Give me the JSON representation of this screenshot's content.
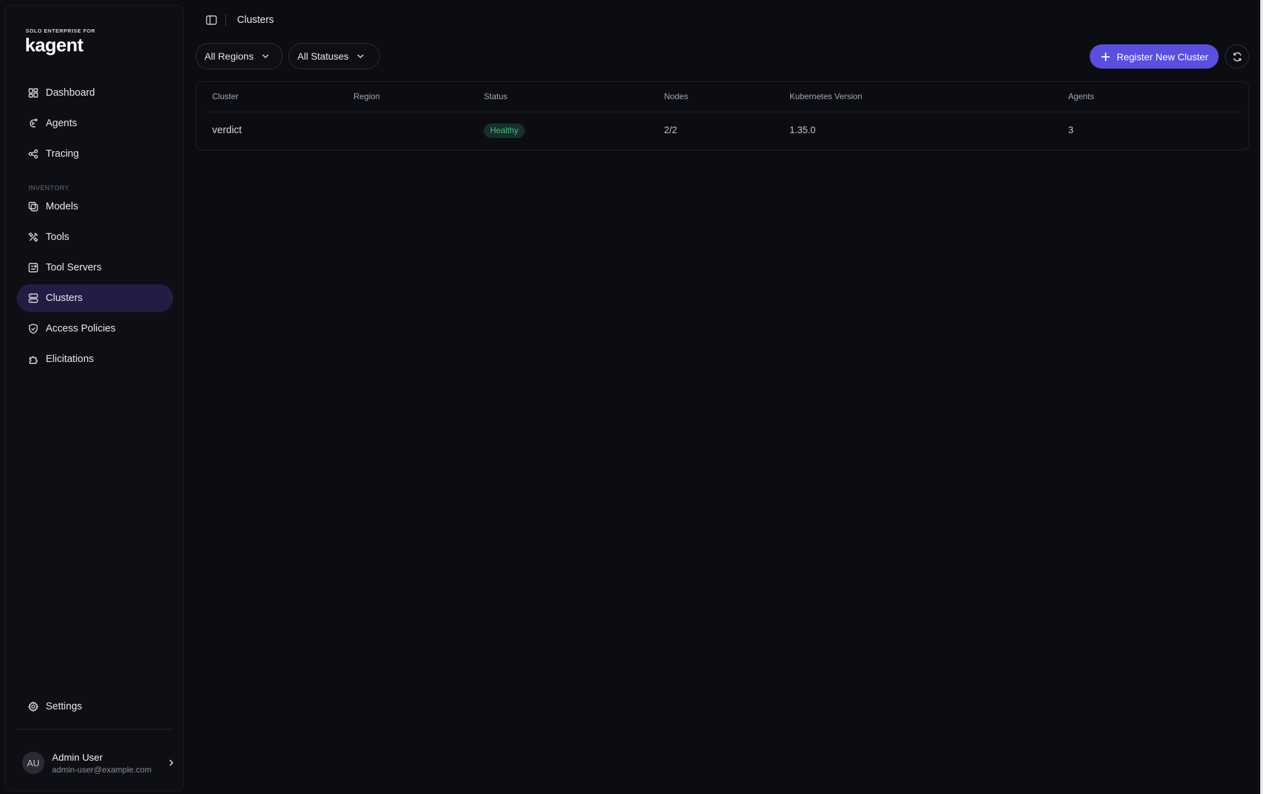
{
  "brand": {
    "subtitle": "SOLO ENTERPRISE FOR",
    "name": "kagent"
  },
  "sidebar": {
    "items": [
      {
        "label": "Dashboard",
        "icon": "dashboard-icon"
      },
      {
        "label": "Agents",
        "icon": "agents-icon"
      },
      {
        "label": "Tracing",
        "icon": "tracing-icon"
      }
    ],
    "section_label": "INVENTORY",
    "inventory_items": [
      {
        "label": "Models",
        "icon": "models-icon"
      },
      {
        "label": "Tools",
        "icon": "tools-icon"
      },
      {
        "label": "Tool Servers",
        "icon": "tool-servers-icon"
      },
      {
        "label": "Clusters",
        "icon": "clusters-icon",
        "active": true
      },
      {
        "label": "Access Policies",
        "icon": "shield-icon"
      },
      {
        "label": "Elicitations",
        "icon": "puzzle-icon"
      }
    ],
    "settings_label": "Settings",
    "user": {
      "initials": "AU",
      "name": "Admin User",
      "email": "admin-user@example.com"
    }
  },
  "header": {
    "breadcrumb": "Clusters"
  },
  "filters": {
    "region": "All Regions",
    "status": "All Statuses"
  },
  "actions": {
    "register_label": "Register New Cluster",
    "accent_color": "#5b4fe0"
  },
  "table": {
    "columns": [
      "Cluster",
      "Region",
      "Status",
      "Nodes",
      "Kubernetes Version",
      "Agents"
    ],
    "rows": [
      {
        "cluster": "verdict",
        "region": "",
        "status": "Healthy",
        "nodes": "2/2",
        "k8s_version": "1.35.0",
        "agents": "3"
      }
    ],
    "status_color": "#4fb987"
  }
}
